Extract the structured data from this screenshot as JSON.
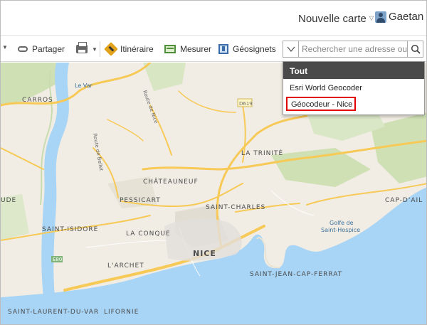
{
  "header": {
    "new_map_label": "Nouvelle carte",
    "user_name": "Gaetan"
  },
  "toolbar": {
    "share_label": "Partager",
    "route_label": "Itinéraire",
    "measure_label": "Mesurer",
    "bookmarks_label": "Géosignets"
  },
  "search": {
    "placeholder": "Rechercher une adresse ou",
    "value": ""
  },
  "dropdown": {
    "header": "Tout",
    "options": [
      "Esri World Geocoder",
      "Géocodeur - Nice"
    ],
    "selected_index": 1,
    "highlight_color": "#e00000"
  },
  "map": {
    "labels": {
      "carros": "CARROS",
      "le_var": "Le Var",
      "route_nice": "Route de Nice",
      "route_bellet": "Route de Bellet",
      "d619": "D619",
      "la_trinite": "LA TRINITÉ",
      "chateauneuf": "CHÂTEAUNEUF",
      "pessicart": "PESSICART",
      "saint_charles": "SAINT-CHARLES",
      "cap_dail": "CAP-D'AIL",
      "golfe": "Golfe de",
      "saint_hospice": "Saint-Hospice",
      "ude": "UDE",
      "saint_isidore": "SAINT-ISIDORE",
      "la_conque": "LA CONQUE",
      "nice": "NICE",
      "larchet": "L'ARCHET",
      "saint_jean": "SAINT-JEAN-CAP-FERRAT",
      "saint_laurent": "SAINT-LAURENT-DU-VAR",
      "lifornie": "LIFORNIE",
      "e80": "E80"
    },
    "colors": {
      "land": "#f1ede4",
      "water": "#a8d4f5",
      "green": "#cfe0b4",
      "road_major": "#f7c956"
    }
  }
}
